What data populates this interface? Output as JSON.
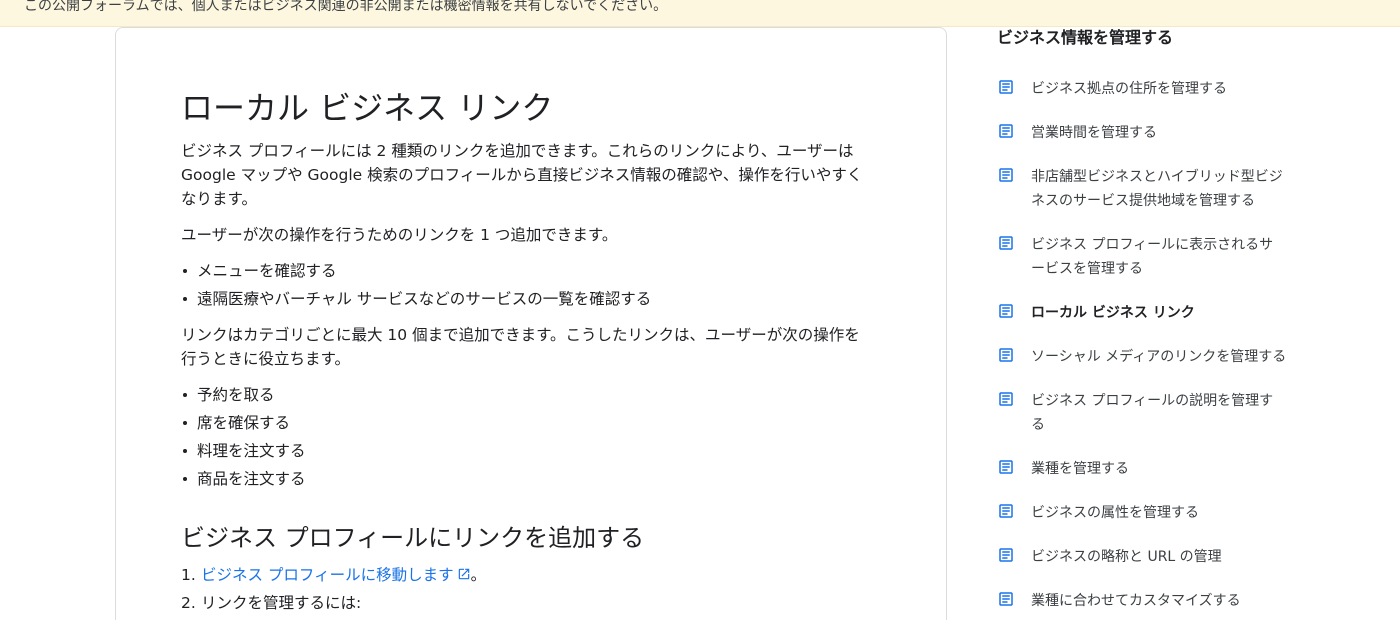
{
  "banner": {
    "text": "この公開フォーラムでは、個人またはビジネス関連の非公開または機密情報を共有しないでください。"
  },
  "article": {
    "title": "ローカル ビジネス リンク",
    "intro_line1": "ビジネス プロフィールには 2 種類のリンクを追加できます。これらのリンクにより、ユーザーは",
    "intro_line2": "Google マップや Google 検索のプロフィールから直接ビジネス情報の確認や、操作を行いやすく",
    "intro_line3": "なります。",
    "single_link_text": "ユーザーが次の操作を行うためのリンクを 1 つ追加できます。",
    "single_link_items": [
      "メニューを確認する",
      "遠隔医療やバーチャル サービスなどのサービスの一覧を確認する"
    ],
    "category_line1": "リンクはカテゴリごとに最大 10 個まで追加できます。こうしたリンクは、ユーザーが次の操作を",
    "category_line2": "行うときに役立ちます。",
    "category_items": [
      "予約を取る",
      "席を確保する",
      "料理を注文する",
      "商品を注文する"
    ],
    "section_heading": "ビジネス プロフィールにリンクを追加する",
    "steps": [
      {
        "num": "1.",
        "link": "ビジネス プロフィールに移動します",
        "suffix": "。"
      },
      {
        "num": "2.",
        "text": "リンクを管理するには:"
      }
    ]
  },
  "sidebar": {
    "title": "ビジネス情報を管理する",
    "icon": "doc-icon",
    "items": [
      {
        "label": "ビジネス拠点の住所を管理する"
      },
      {
        "label": "営業時間を管理する"
      },
      {
        "label": "非店舗型ビジネスとハイブリッド型ビジネスのサービス提供地域を管理する"
      },
      {
        "label": "ビジネス プロフィールに表示されるサービスを管理する"
      },
      {
        "label": "ローカル ビジネス リンク"
      },
      {
        "label": "ソーシャル メディアのリンクを管理する"
      },
      {
        "label": "ビジネス プロフィールの説明を管理する"
      },
      {
        "label": "業種を管理する"
      },
      {
        "label": "ビジネスの属性を管理する"
      },
      {
        "label": "ビジネスの略称と URL の管理"
      },
      {
        "label": "業種に合わせてカスタマイズする"
      }
    ]
  },
  "colors": {
    "banner_bg": "#fef7e0",
    "link": "#1a73e8",
    "icon": "#1a73e8",
    "text": "#202124"
  }
}
